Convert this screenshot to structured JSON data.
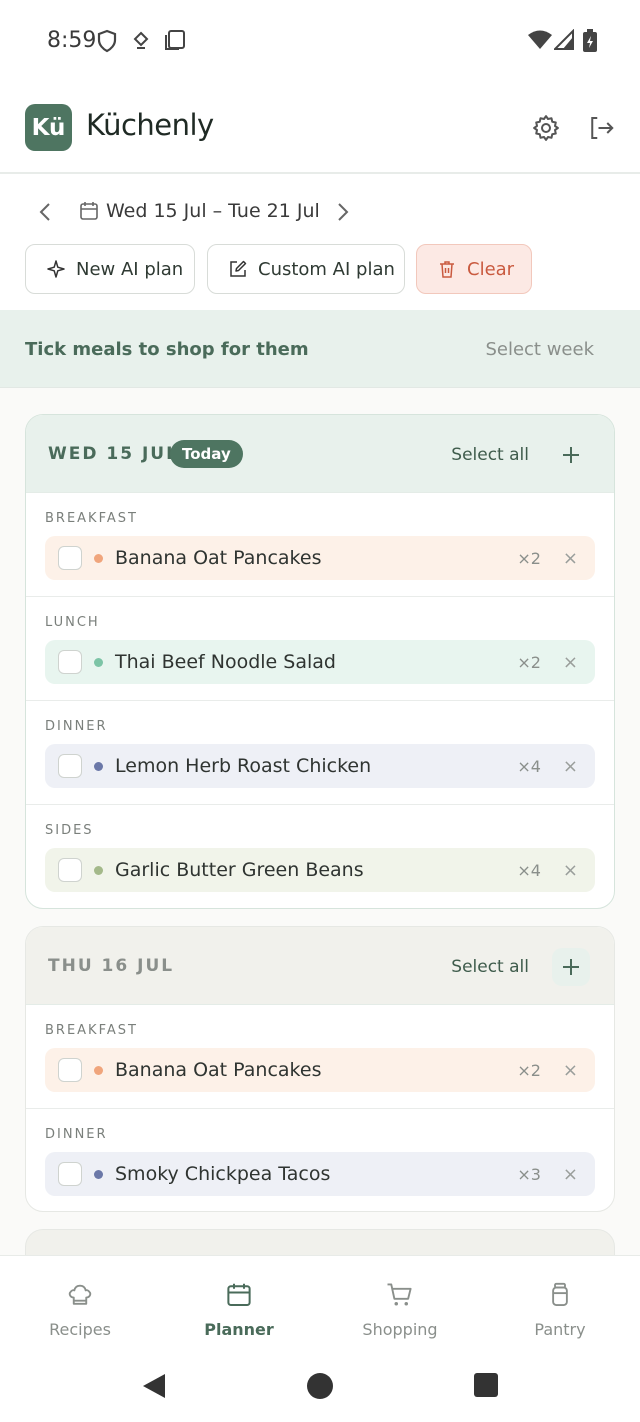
{
  "status": {
    "time": "8:59"
  },
  "app": {
    "logo_text": "Kü",
    "title": "Küchenly"
  },
  "week": {
    "label": "Wed 15 Jul – Tue 21 Jul"
  },
  "actions": {
    "new_ai": "New AI plan",
    "custom_ai": "Custom AI plan",
    "clear": "Clear"
  },
  "hint": {
    "text": "Tick meals to shop for them",
    "select_week": "Select week"
  },
  "days": [
    {
      "title": "WED 15 JUL",
      "badge": "Today",
      "select_all": "Select all",
      "slots": [
        {
          "label": "BREAKFAST",
          "meal": "Banana Oat Pancakes",
          "qty": "×2"
        },
        {
          "label": "LUNCH",
          "meal": "Thai Beef Noodle Salad",
          "qty": "×2"
        },
        {
          "label": "DINNER",
          "meal": "Lemon Herb Roast Chicken",
          "qty": "×4"
        },
        {
          "label": "SIDES",
          "meal": "Garlic Butter Green Beans",
          "qty": "×4"
        }
      ]
    },
    {
      "title": "THU 16 JUL",
      "select_all": "Select all",
      "slots": [
        {
          "label": "BREAKFAST",
          "meal": "Banana Oat Pancakes",
          "qty": "×2"
        },
        {
          "label": "DINNER",
          "meal": "Smoky Chickpea Tacos",
          "qty": "×3"
        }
      ]
    }
  ],
  "remove_symbol": "×",
  "nav": {
    "recipes": "Recipes",
    "planner": "Planner",
    "shopping": "Shopping",
    "pantry": "Pantry"
  },
  "colors": {
    "brand": "#4e7561",
    "breakfast_bg": "#fdf1e8",
    "breakfast_dot": "#f0a57c",
    "lunch_bg": "#e8f5ef",
    "lunch_dot": "#7cc4a6",
    "dinner_bg": "#eef0f6",
    "dinner_dot": "#6b78a8",
    "sides_bg": "#f1f4ea",
    "sides_dot": "#a4b98a"
  }
}
